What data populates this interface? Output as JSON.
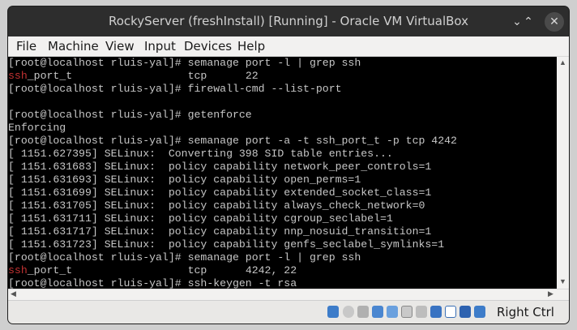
{
  "window": {
    "title": "RockyServer (freshInstall) [Running] - Oracle VM VirtualBox",
    "minimize_glyph": "⌄",
    "maximize_glyph": "⌃",
    "close_glyph": "✕"
  },
  "menu": {
    "items": [
      "File",
      "Machine",
      "View",
      "Input",
      "Devices",
      "Help"
    ]
  },
  "terminal": {
    "lines": [
      {
        "a": "",
        "b": "[root@localhost rluis-yal]# semanage port -l | grep ssh"
      },
      {
        "a": "ssh",
        "b": "_port_t                  tcp      22"
      },
      {
        "a": "",
        "b": "[root@localhost rluis-yal]# firewall-cmd --list-port"
      },
      {
        "a": "",
        "b": ""
      },
      {
        "a": "",
        "b": "[root@localhost rluis-yal]# getenforce"
      },
      {
        "a": "",
        "b": "Enforcing"
      },
      {
        "a": "",
        "b": "[root@localhost rluis-yal]# semanage port -a -t ssh_port_t -p tcp 4242"
      },
      {
        "a": "",
        "b": "[ 1151.627395] SELinux:  Converting 398 SID table entries..."
      },
      {
        "a": "",
        "b": "[ 1151.631683] SELinux:  policy capability network_peer_controls=1"
      },
      {
        "a": "",
        "b": "[ 1151.631693] SELinux:  policy capability open_perms=1"
      },
      {
        "a": "",
        "b": "[ 1151.631699] SELinux:  policy capability extended_socket_class=1"
      },
      {
        "a": "",
        "b": "[ 1151.631705] SELinux:  policy capability always_check_network=0"
      },
      {
        "a": "",
        "b": "[ 1151.631711] SELinux:  policy capability cgroup_seclabel=1"
      },
      {
        "a": "",
        "b": "[ 1151.631717] SELinux:  policy capability nnp_nosuid_transition=1"
      },
      {
        "a": "",
        "b": "[ 1151.631723] SELinux:  policy capability genfs_seclabel_symlinks=1"
      },
      {
        "a": "",
        "b": "[root@localhost rluis-yal]# semanage port -l | grep ssh"
      },
      {
        "a": "ssh",
        "b": "_port_t                  tcp      4242, 22"
      },
      {
        "a": "",
        "b": "[root@localhost rluis-yal]# ssh-keygen -t rsa"
      }
    ]
  },
  "statusbar": {
    "icons": [
      "hard-disk-icon",
      "optical-drive-icon",
      "audio-icon",
      "network-icon",
      "usb-icon",
      "shared-folder-icon",
      "display-icon",
      "video-capture-icon",
      "cpu-icon",
      "mouse-integration-icon",
      "keyboard-icon"
    ],
    "host_key_label": "Right Ctrl"
  },
  "colors": {
    "terminal_bg": "#000000",
    "terminal_fg": "#c6c6c6",
    "highlight_red": "#c33232",
    "titlebar_bg": "#2d2d2d",
    "menubar_bg": "#f2f1f0"
  }
}
